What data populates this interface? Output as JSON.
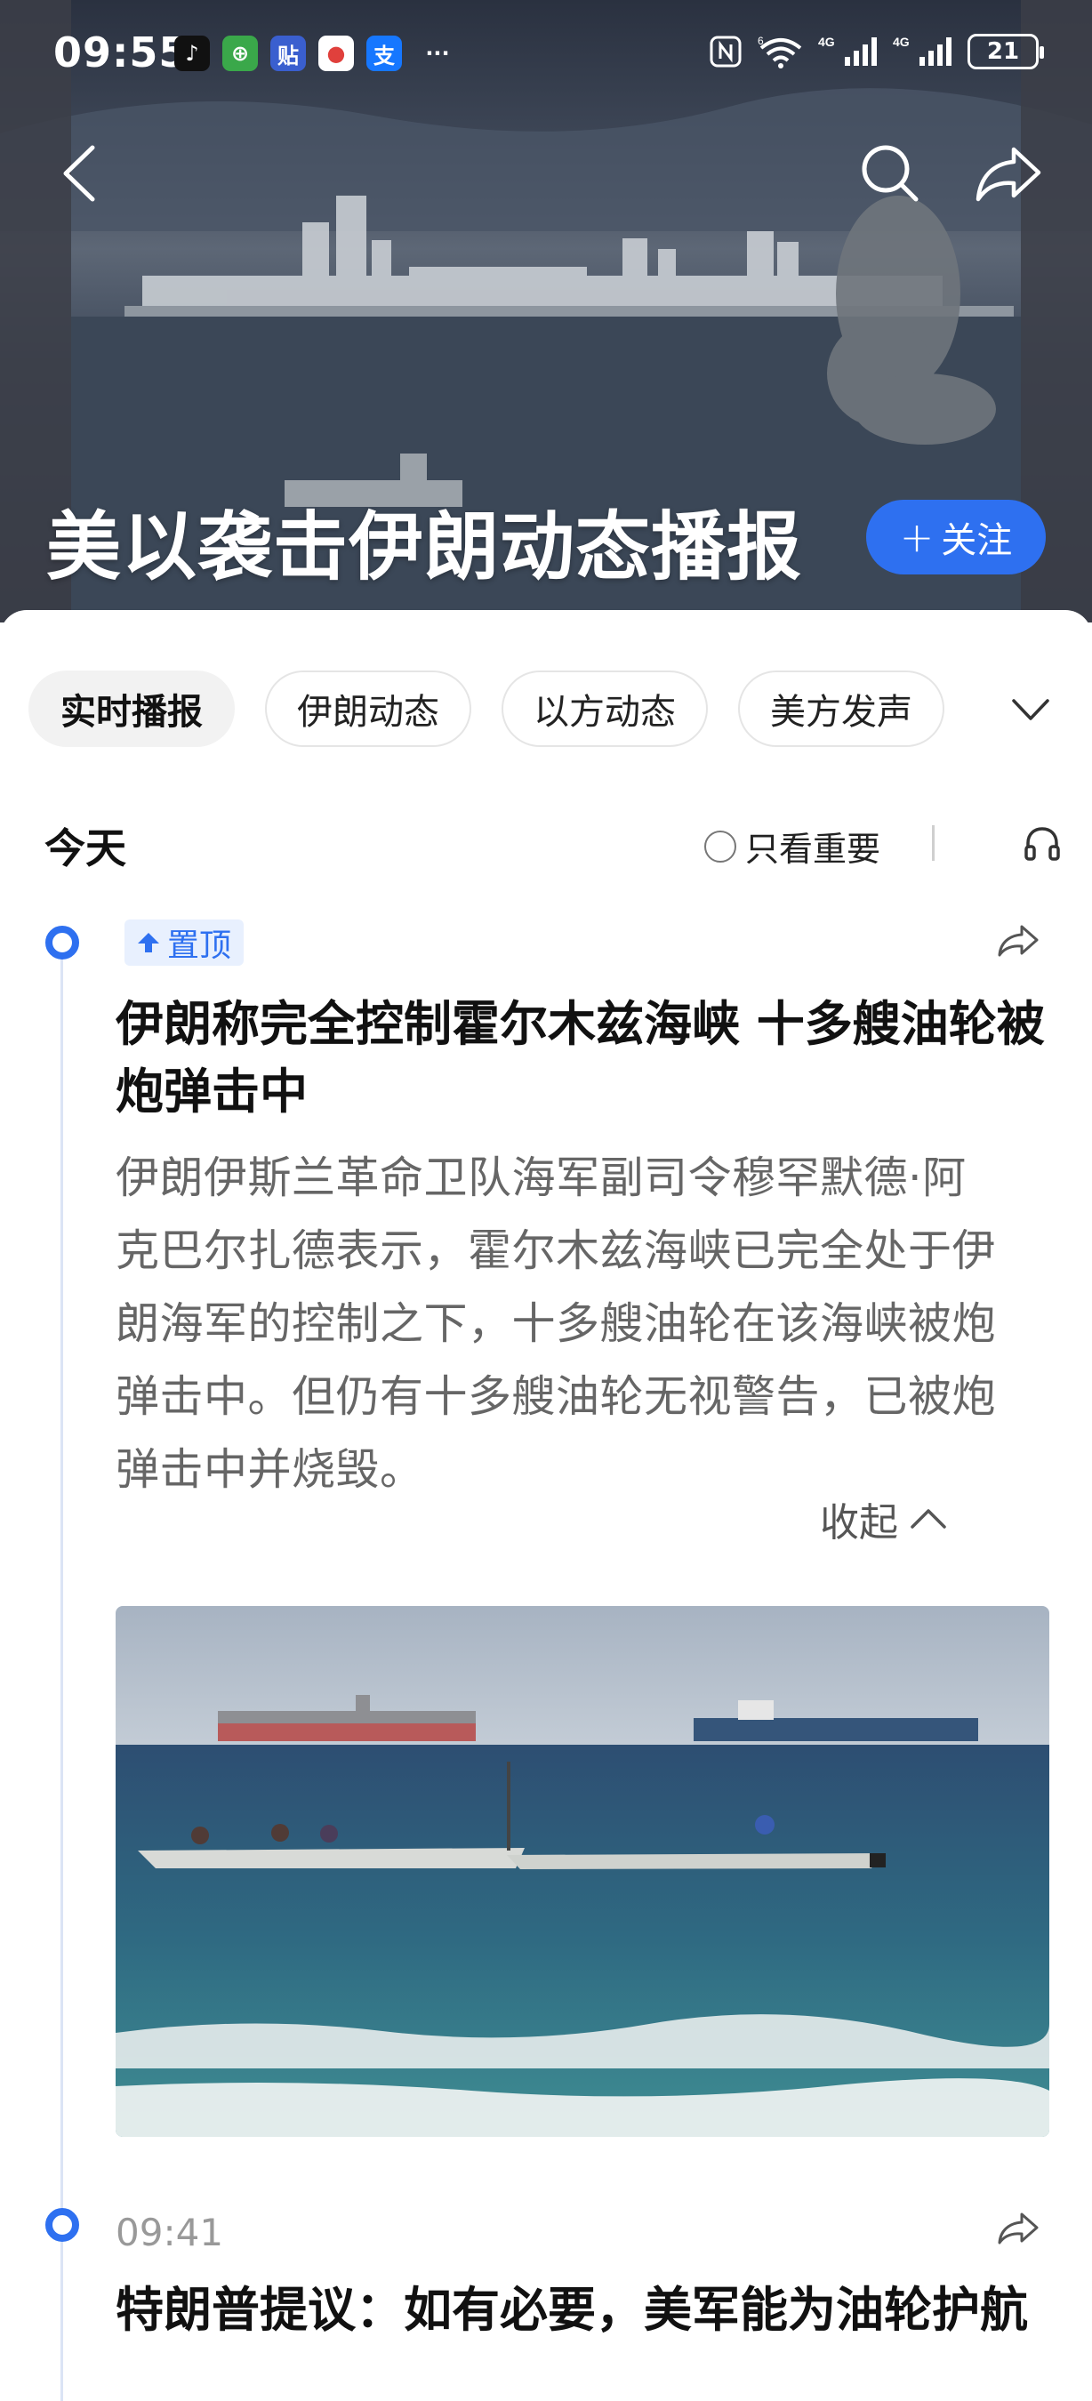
{
  "status_bar": {
    "time": "09:55",
    "apps": [
      {
        "icon": "tiktok-icon",
        "glyph": "♪",
        "bg": "#111111",
        "fg": "#ffffff"
      },
      {
        "icon": "green-app-icon",
        "glyph": "⊕",
        "bg": "#3aa84a",
        "fg": "#ffffff"
      },
      {
        "icon": "tieba-icon",
        "glyph": "贴",
        "bg": "#3a5fcf",
        "fg": "#ffffff"
      },
      {
        "icon": "map-pin-app-icon",
        "glyph": "●",
        "bg": "#ffffff",
        "fg": "#e0403c"
      },
      {
        "icon": "alipay-icon",
        "glyph": "支",
        "bg": "#1677ff",
        "fg": "#ffffff"
      }
    ],
    "more": "···",
    "battery": "21",
    "signal_labels": [
      "6",
      "4G",
      "4G"
    ]
  },
  "header": {
    "title": "美以袭击伊朗动态播报",
    "follow_label": "关注"
  },
  "tabs": [
    "实时播报",
    "伊朗动态",
    "以方动态",
    "美方发声"
  ],
  "feed": {
    "day_label": "今天",
    "only_important_label": "只看重要",
    "items": [
      {
        "badge": "置顶",
        "title": "伊朗称完全控制霍尔木兹海峡 十多艘油轮被炮弹击中",
        "body_lines": [
          "伊朗伊斯兰革命卫队海军副司令穆罕默德·阿",
          "克巴尔扎德表示，霍尔木兹海峡已完全处于伊",
          "朗海军的控制之下，十多艘油轮在该海峡被炮",
          "弹击中。但仍有十多艘油轮无视警告，已被炮",
          "弹击中并烧毁。"
        ],
        "collapse_label": "收起"
      },
      {
        "time": "09:41",
        "title": "特朗普提议：如有必要，美军能为油轮护航"
      }
    ]
  },
  "colors": {
    "accent": "#2e70f0",
    "badge_bg": "#e8f0fe",
    "timeline": "#dbe4f5"
  }
}
